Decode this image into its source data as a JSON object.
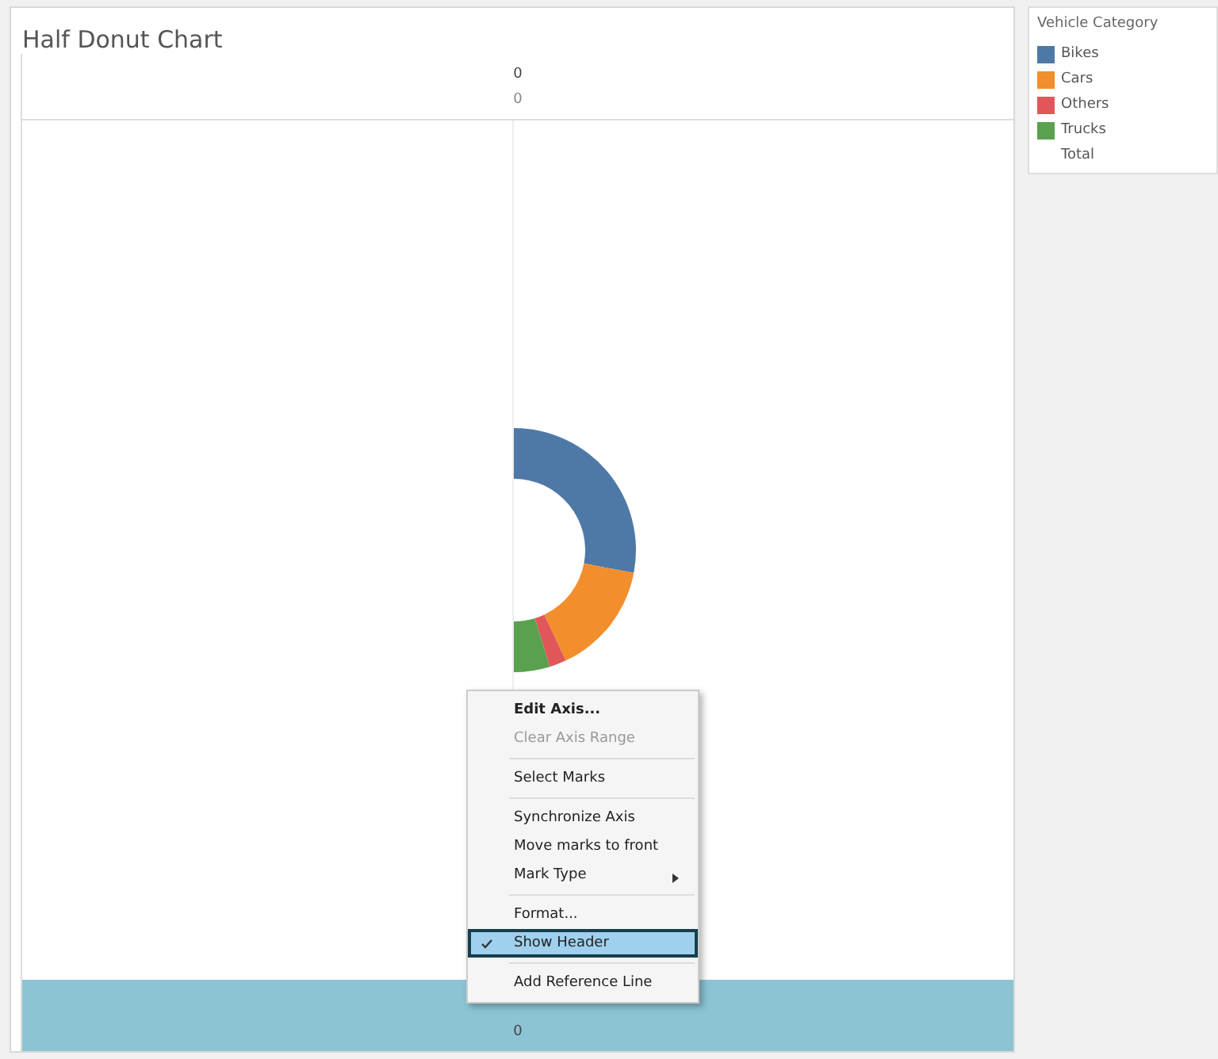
{
  "title": "Half Donut Chart",
  "top_header": [
    "0",
    "0"
  ],
  "bottom_header": [
    "0"
  ],
  "legend": {
    "title": "Vehicle Category",
    "items": [
      {
        "label": "Bikes",
        "color": "#4e79a7"
      },
      {
        "label": "Cars",
        "color": "#f28e2b"
      },
      {
        "label": "Others",
        "color": "#e15759"
      },
      {
        "label": "Trucks",
        "color": "#59a14f"
      },
      {
        "label": "Total"
      }
    ]
  },
  "context_menu": {
    "groups": [
      [
        {
          "label": "Edit Axis...",
          "default": true,
          "disabled": false,
          "checked": false,
          "submenu": false
        },
        {
          "label": "Clear Axis Range",
          "default": false,
          "disabled": true,
          "checked": false,
          "submenu": false
        }
      ],
      [
        {
          "label": "Select Marks",
          "default": false,
          "disabled": false,
          "checked": false,
          "submenu": false
        }
      ],
      [
        {
          "label": "Synchronize Axis",
          "default": false,
          "disabled": false,
          "checked": false,
          "submenu": false
        },
        {
          "label": "Move marks to front",
          "default": false,
          "disabled": false,
          "checked": false,
          "submenu": false
        },
        {
          "label": "Mark Type",
          "default": false,
          "disabled": false,
          "checked": false,
          "submenu": true
        }
      ],
      [
        {
          "label": "Format...",
          "default": false,
          "disabled": false,
          "checked": false,
          "submenu": false
        },
        {
          "label": "Show Header",
          "default": false,
          "disabled": false,
          "checked": true,
          "submenu": false
        }
      ],
      [
        {
          "label": "Add Reference Line",
          "default": false,
          "disabled": false,
          "checked": false,
          "submenu": false
        }
      ]
    ]
  }
}
